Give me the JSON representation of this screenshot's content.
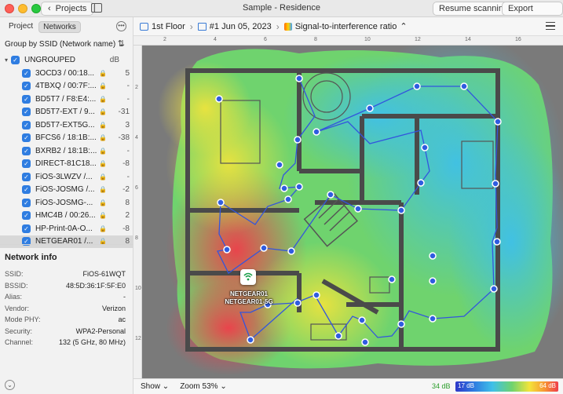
{
  "window": {
    "title": "Sample - Residence",
    "back_label": "Projects",
    "resume_label": "Resume scanning",
    "export_label": "Export report..."
  },
  "sidebar": {
    "tab_project": "Project",
    "tab_networks": "Networks",
    "group_by": "Group by SSID (Network name)",
    "ungrouped_label": "UNGROUPED",
    "db_header": "dB",
    "networks": [
      {
        "name": "3OCD3 / 00:18...",
        "db": "5",
        "selected": false
      },
      {
        "name": "4TBXQ / 00:7F:...",
        "db": "-",
        "selected": false
      },
      {
        "name": "BD5T7 / F8:E4:...",
        "db": "-",
        "selected": false
      },
      {
        "name": "BD5T7-EXT / 9...",
        "db": "-31",
        "selected": false
      },
      {
        "name": "BD5T7-EXT5G...",
        "db": "3",
        "selected": false
      },
      {
        "name": "BFCS6 / 18:1B:...",
        "db": "-38",
        "selected": false
      },
      {
        "name": "BXRB2 / 18:1B:...",
        "db": "-",
        "selected": false
      },
      {
        "name": "DIRECT-81C18...",
        "db": "-8",
        "selected": false
      },
      {
        "name": "FiOS-3LWZV /...",
        "db": "-",
        "selected": false
      },
      {
        "name": "FiOS-JOSMG /...",
        "db": "-2",
        "selected": false
      },
      {
        "name": "FiOS-JOSMG-...",
        "db": "8",
        "selected": false
      },
      {
        "name": "HMC4B / 00:26...",
        "db": "2",
        "selected": false
      },
      {
        "name": "HP-Print-0A-O...",
        "db": "-8",
        "selected": false
      },
      {
        "name": "NETGEAR01 /...",
        "db": "8",
        "selected": true
      }
    ],
    "info_title": "Network info",
    "info": [
      {
        "key": "SSID:",
        "value": "FiOS-61WQT"
      },
      {
        "key": "BSSID:",
        "value": "48:5D:36:1F:5F:E0"
      },
      {
        "key": "Alias:",
        "value": "-"
      },
      {
        "key": "Vendor:",
        "value": "Verizon"
      },
      {
        "key": "Mode PHY:",
        "value": "ac"
      },
      {
        "key": "Security:",
        "value": "WPA2-Personal"
      },
      {
        "key": "Channel:",
        "value": "132 (5 GHz, 80 MHz)"
      }
    ]
  },
  "toolbar": {
    "floor": "1st Floor",
    "scan": "#1 Jun 05, 2023",
    "visualization": "Signal-to-interference ratio"
  },
  "rulers": {
    "top": [
      "2",
      "4",
      "6",
      "8",
      "10",
      "12",
      "14",
      "16"
    ],
    "left": [
      "2",
      "4",
      "6",
      "8",
      "10",
      "12"
    ]
  },
  "canvas": {
    "ap_label_1": "NETGEAR01",
    "ap_label_2": "NETGEAR01-5G"
  },
  "status": {
    "show_label": "Show",
    "zoom_label": "Zoom 53%",
    "legend_min": "34 dB",
    "legend_lo": "17 dB",
    "legend_hi": "64 dB"
  },
  "colors": {
    "accent": "#2f7de1",
    "wall": "#4a4a4a",
    "heat_hot": "#ef3d4a",
    "heat_warm": "#f3e43b",
    "heat_mid": "#6fd36e",
    "heat_cool": "#3fc0e8"
  }
}
